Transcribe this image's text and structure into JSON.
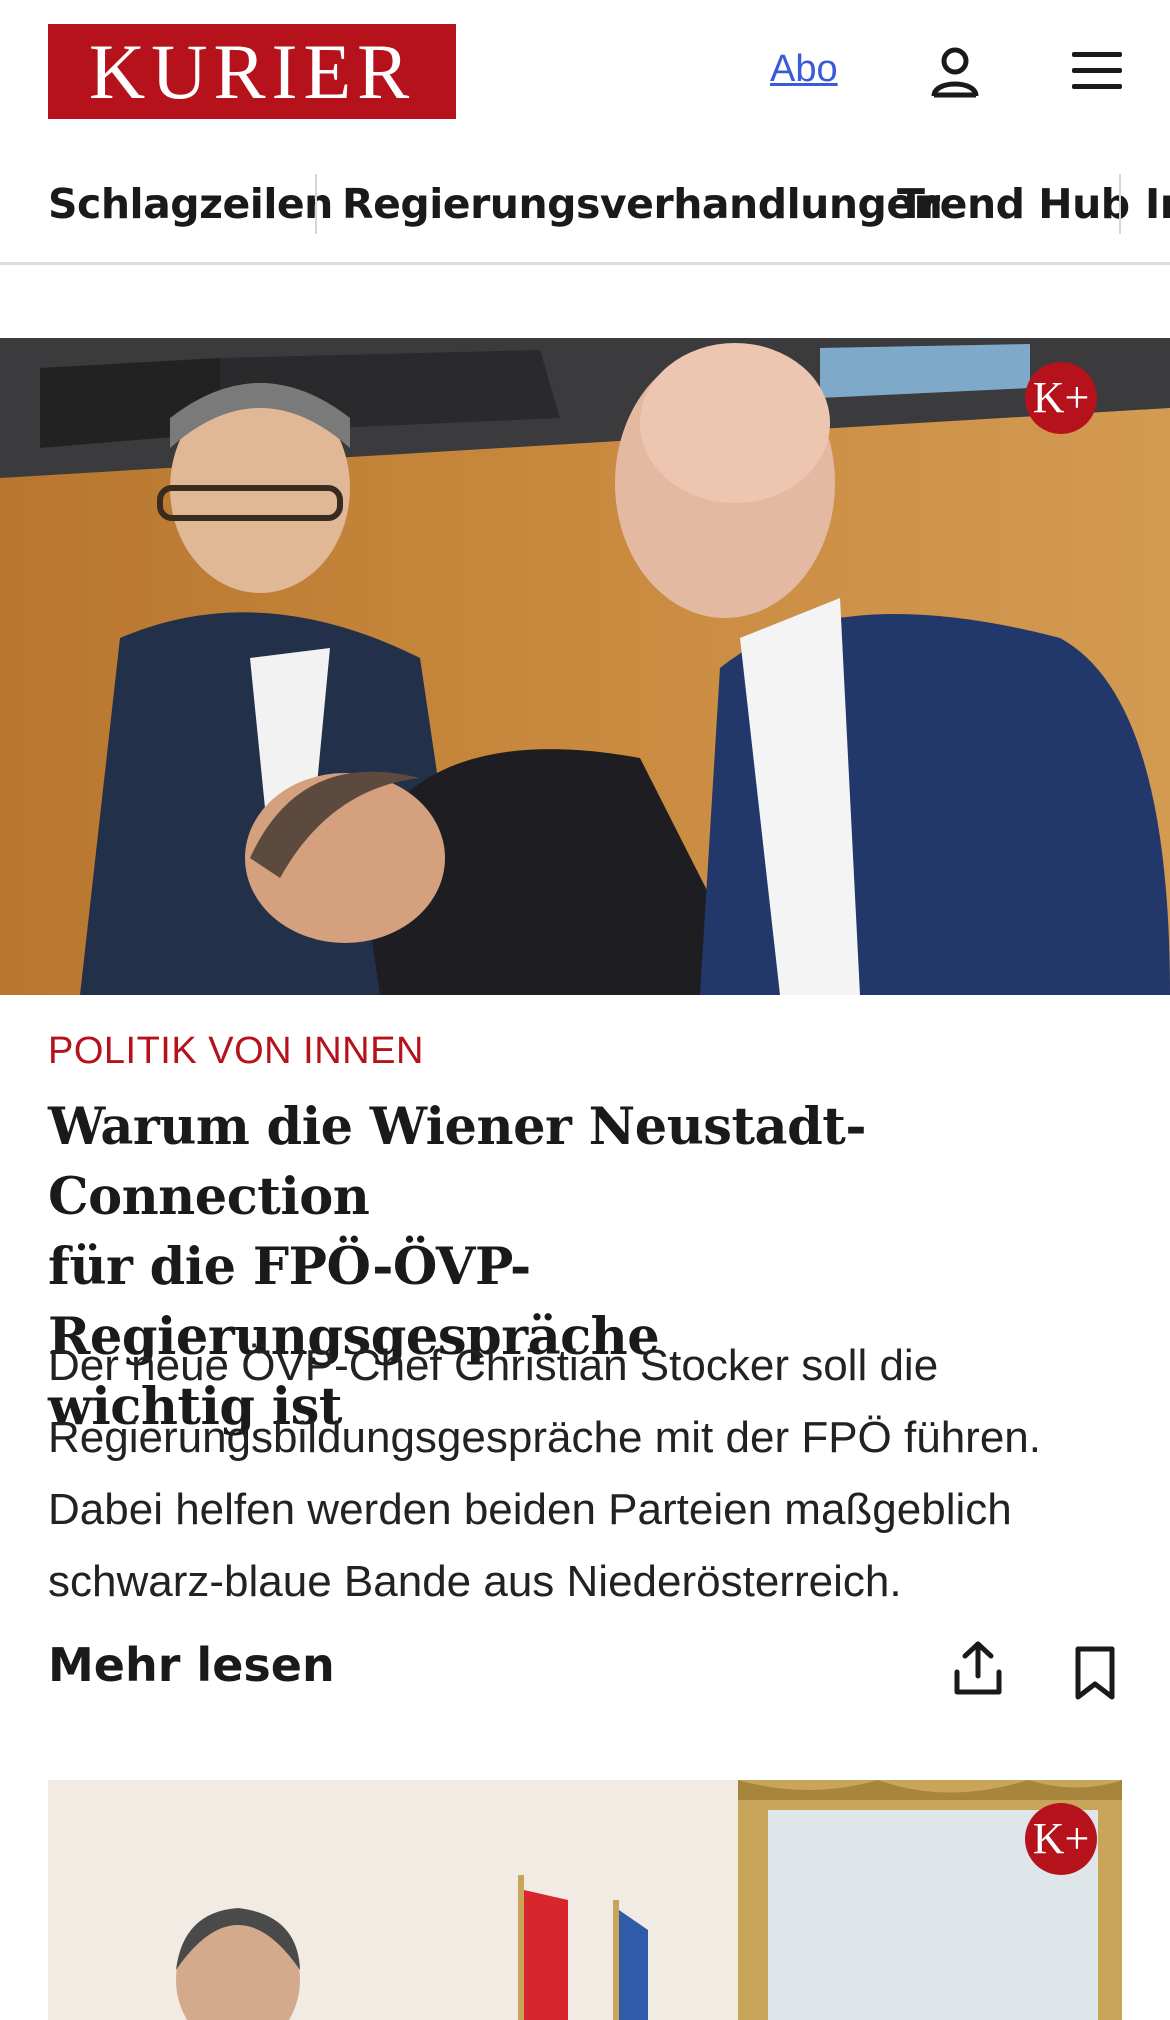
{
  "header": {
    "logo_text": "KURIER",
    "abo_label": "Abo",
    "account_icon": "user-icon",
    "menu_icon": "hamburger-menu-icon"
  },
  "nav": {
    "items": [
      "Schlagzeilen",
      "Regierungsverhandlungen",
      "Trend Hub",
      "In"
    ]
  },
  "article": {
    "premium_badge": "K+",
    "kicker": "POLITIK VON INNEN",
    "headline_lines": [
      "Warum die Wiener Neustadt-Connection",
      "für die FPÖ-ÖVP-Regierungsgespräche",
      "wichtig ist"
    ],
    "teaser_lines": [
      "Der neue ÖVP-Chef Christian Stocker soll die",
      "Regierungsbildungsgespräche mit der FPÖ führen.",
      "Dabei helfen werden beiden Parteien maßgeblich",
      "schwarz-blaue Bande aus Niederösterreich."
    ],
    "more_label": "Mehr lesen",
    "share_icon": "share-icon",
    "bookmark_icon": "bookmark-icon"
  },
  "second_article": {
    "premium_badge": "K+"
  },
  "colors": {
    "brand_red": "#b5121b",
    "link_blue": "#3a5bd9",
    "text": "#1a1a1a"
  }
}
